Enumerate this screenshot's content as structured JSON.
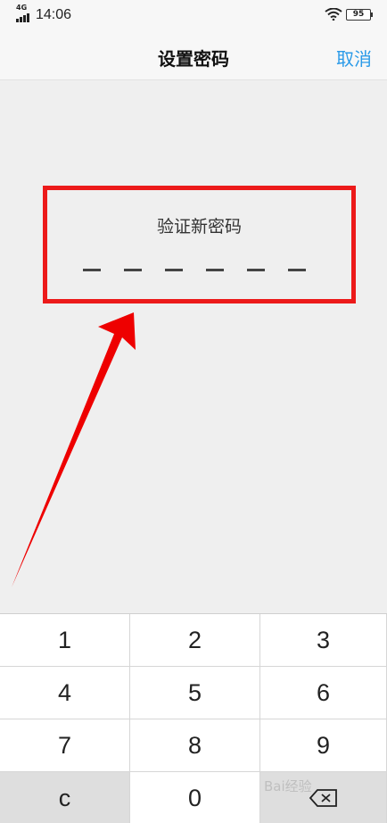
{
  "status_bar": {
    "network": "4G",
    "time": "14:06",
    "battery": "95"
  },
  "nav": {
    "title": "设置密码",
    "cancel_label": "取消"
  },
  "password_panel": {
    "title": "验证新密码",
    "digit_count": 6,
    "entered_count": 0
  },
  "keypad": {
    "keys": [
      "1",
      "2",
      "3",
      "4",
      "5",
      "6",
      "7",
      "8",
      "9",
      "c",
      "0",
      "⌫"
    ]
  },
  "watermark": "Bai经验",
  "colors": {
    "accent": "#2a9ae8",
    "highlight_box": "#ec1a1a",
    "annotation_arrow": "#ee0000"
  },
  "icons": {
    "signal": "signal-icon",
    "wifi": "wifi-icon",
    "backspace": "backspace-icon"
  }
}
